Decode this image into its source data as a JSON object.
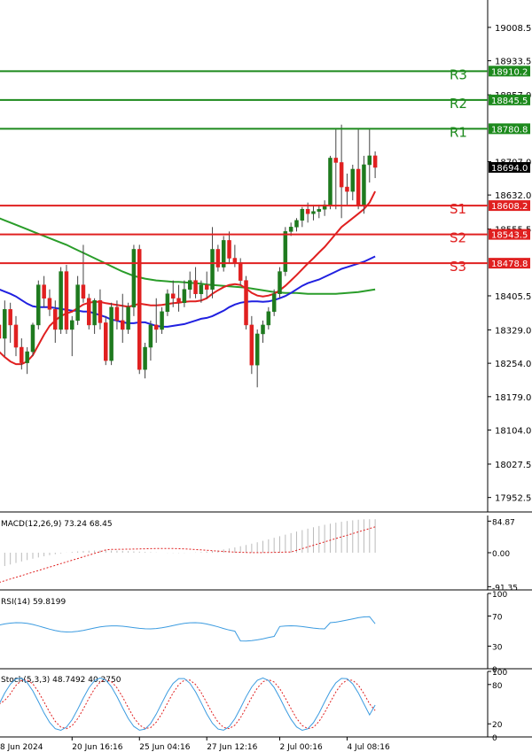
{
  "chart_data": {
    "type": "candlestick",
    "main": {
      "y_ticks": [
        "19008.5",
        "18933.5",
        "18857.0",
        "18707.0",
        "18632.0",
        "18555.5",
        "18405.5",
        "18329.0",
        "18254.0",
        "18179.0",
        "18104.0",
        "18027.5",
        "17952.5"
      ],
      "ylim": [
        17920,
        19070
      ],
      "last_price": "18694.0",
      "levels": [
        {
          "name": "R3",
          "price": 18910.2,
          "label": "18910.2",
          "color": "#1d8a1d"
        },
        {
          "name": "R2",
          "price": 18845.5,
          "label": "18845.5",
          "color": "#1d8a1d"
        },
        {
          "name": "R1",
          "price": 18780.8,
          "label": "18780.8",
          "color": "#1d8a1d"
        },
        {
          "name": "S1",
          "price": 18608.2,
          "label": "18608.2",
          "color": "#e02020"
        },
        {
          "name": "S2",
          "price": 18543.5,
          "label": "18543.5",
          "color": "#e02020"
        },
        {
          "name": "S3",
          "price": 18478.8,
          "label": "18478.8",
          "color": "#e02020"
        }
      ],
      "candles": [
        [
          18340,
          18385,
          18260,
          18310
        ],
        [
          18310,
          18395,
          18270,
          18375
        ],
        [
          18375,
          18390,
          18300,
          18340
        ],
        [
          18340,
          18360,
          18270,
          18290
        ],
        [
          18290,
          18310,
          18240,
          18255
        ],
        [
          18255,
          18290,
          18230,
          18280
        ],
        [
          18280,
          18345,
          18270,
          18340
        ],
        [
          18340,
          18440,
          18330,
          18430
        ],
        [
          18430,
          18450,
          18380,
          18400
        ],
        [
          18400,
          18420,
          18360,
          18375
        ],
        [
          18375,
          18395,
          18300,
          18330
        ],
        [
          18330,
          18470,
          18320,
          18460
        ],
        [
          18460,
          18475,
          18320,
          18330
        ],
        [
          18330,
          18360,
          18270,
          18350
        ],
        [
          18350,
          18450,
          18340,
          18430
        ],
        [
          18430,
          18520,
          18390,
          18400
        ],
        [
          18400,
          18410,
          18330,
          18340
        ],
        [
          18340,
          18400,
          18320,
          18395
        ],
        [
          18395,
          18420,
          18330,
          18345
        ],
        [
          18345,
          18360,
          18250,
          18260
        ],
        [
          18260,
          18390,
          18250,
          18380
        ],
        [
          18380,
          18395,
          18330,
          18350
        ],
        [
          18350,
          18410,
          18300,
          18330
        ],
        [
          18330,
          18390,
          18320,
          18380
        ],
        [
          18380,
          18520,
          18360,
          18510
        ],
        [
          18510,
          18520,
          18230,
          18240
        ],
        [
          18240,
          18300,
          18220,
          18290
        ],
        [
          18290,
          18350,
          18260,
          18340
        ],
        [
          18340,
          18400,
          18300,
          18330
        ],
        [
          18330,
          18380,
          18320,
          18370
        ],
        [
          18370,
          18420,
          18360,
          18410
        ],
        [
          18410,
          18440,
          18380,
          18400
        ],
        [
          18400,
          18430,
          18370,
          18390
        ],
        [
          18390,
          18440,
          18380,
          18420
        ],
        [
          18420,
          18460,
          18400,
          18440
        ],
        [
          18440,
          18470,
          18400,
          18410
        ],
        [
          18410,
          18440,
          18390,
          18430
        ],
        [
          18430,
          18460,
          18400,
          18420
        ],
        [
          18420,
          18560,
          18400,
          18510
        ],
        [
          18510,
          18520,
          18460,
          18470
        ],
        [
          18470,
          18540,
          18460,
          18530
        ],
        [
          18530,
          18550,
          18480,
          18490
        ],
        [
          18490,
          18520,
          18470,
          18480
        ],
        [
          18480,
          18490,
          18430,
          18440
        ],
        [
          18440,
          18450,
          18330,
          18340
        ],
        [
          18340,
          18360,
          18230,
          18250
        ],
        [
          18250,
          18330,
          18200,
          18320
        ],
        [
          18320,
          18350,
          18300,
          18340
        ],
        [
          18340,
          18380,
          18330,
          18370
        ],
        [
          18370,
          18420,
          18360,
          18410
        ],
        [
          18410,
          18470,
          18400,
          18460
        ],
        [
          18460,
          18560,
          18450,
          18550
        ],
        [
          18550,
          18570,
          18540,
          18560
        ],
        [
          18560,
          18580,
          18550,
          18575
        ],
        [
          18575,
          18605,
          18560,
          18600
        ],
        [
          18600,
          18615,
          18570,
          18590
        ],
        [
          18590,
          18610,
          18575,
          18595
        ],
        [
          18595,
          18610,
          18580,
          18600
        ],
        [
          18600,
          18620,
          18585,
          18610
        ],
        [
          18610,
          18720,
          18600,
          18715
        ],
        [
          18715,
          18780,
          18600,
          18705
        ],
        [
          18705,
          18790,
          18580,
          18650
        ],
        [
          18650,
          18680,
          18610,
          18640
        ],
        [
          18640,
          18700,
          18620,
          18690
        ],
        [
          18690,
          18780,
          18600,
          18610
        ],
        [
          18610,
          18720,
          18590,
          18700
        ],
        [
          18700,
          18780,
          18660,
          18720
        ],
        [
          18720,
          18730,
          18670,
          18694
        ]
      ],
      "ma_red": [
        18280,
        18268,
        18258,
        18252,
        18252,
        18258,
        18272,
        18295,
        18318,
        18338,
        18350,
        18360,
        18366,
        18370,
        18378,
        18386,
        18390,
        18392,
        18392,
        18389,
        18387,
        18385,
        18383,
        18381,
        18384,
        18388,
        18386,
        18384,
        18384,
        18385,
        18387,
        18389,
        18390,
        18392,
        18393,
        18393,
        18395,
        18400,
        18410,
        18418,
        18425,
        18430,
        18432,
        18430,
        18422,
        18412,
        18406,
        18404,
        18406,
        18410,
        18418,
        18428,
        18440,
        18452,
        18465,
        18478,
        18490,
        18503,
        18515,
        18530,
        18545,
        18560,
        18570,
        18580,
        18590,
        18600,
        18615,
        18640
      ],
      "ma_blue": [
        18420,
        18415,
        18410,
        18404,
        18396,
        18388,
        18382,
        18380,
        18380,
        18380,
        18378,
        18376,
        18374,
        18372,
        18372,
        18370,
        18370,
        18366,
        18362,
        18358,
        18352,
        18350,
        18346,
        18344,
        18344,
        18346,
        18346,
        18342,
        18338,
        18336,
        18336,
        18338,
        18340,
        18342,
        18346,
        18350,
        18354,
        18356,
        18360,
        18366,
        18372,
        18380,
        18386,
        18390,
        18392,
        18393,
        18393,
        18392,
        18393,
        18396,
        18400,
        18405,
        18412,
        18420,
        18428,
        18434,
        18438,
        18442,
        18448,
        18454,
        18460,
        18466,
        18470,
        18474,
        18478,
        18482,
        18488,
        18494
      ],
      "ma_green": [
        18580,
        18575,
        18570,
        18565,
        18560,
        18555,
        18550,
        18545,
        18540,
        18535,
        18530,
        18525,
        18520,
        18514,
        18508,
        18502,
        18496,
        18490,
        18484,
        18478,
        18472,
        18466,
        18460,
        18455,
        18450,
        18447,
        18444,
        18442,
        18440,
        18439,
        18438,
        18437,
        18437,
        18436,
        18435,
        18434,
        18433,
        18431,
        18430,
        18429,
        18428,
        18427,
        18426,
        18425,
        18424,
        18422,
        18420,
        18418,
        18416,
        18414,
        18413,
        18412,
        18412,
        18412,
        18411,
        18410,
        18410,
        18410,
        18410,
        18410,
        18410,
        18411,
        18412,
        18413,
        18414,
        18416,
        18418,
        18420
      ]
    },
    "macd": {
      "label": "MACD(12,26,9) 73.24 68.45",
      "ticks": [
        "84.87",
        "0.00",
        "-91.35"
      ],
      "ylim": [
        -100,
        100
      ]
    },
    "rsi": {
      "label": "RSI(14) 59.8199",
      "ticks": [
        "100",
        "70",
        "30",
        "0"
      ],
      "ylim": [
        0,
        100
      ]
    },
    "stoch": {
      "label": "Stoch(5,3,3) 48.7492 40.2750",
      "ticks": [
        "100",
        "80",
        "20",
        "0"
      ],
      "ylim": [
        0,
        100
      ]
    },
    "x_labels": [
      {
        "text": "8 Jun 2024",
        "index": 0
      },
      {
        "text": "20 Jun 16:16",
        "index": 13
      },
      {
        "text": "25 Jun 04:16",
        "index": 25
      },
      {
        "text": "27 Jun 12:16",
        "index": 37
      },
      {
        "text": "2 Jul 00:16",
        "index": 50
      },
      {
        "text": "4 Jul 08:16",
        "index": 62
      }
    ]
  }
}
